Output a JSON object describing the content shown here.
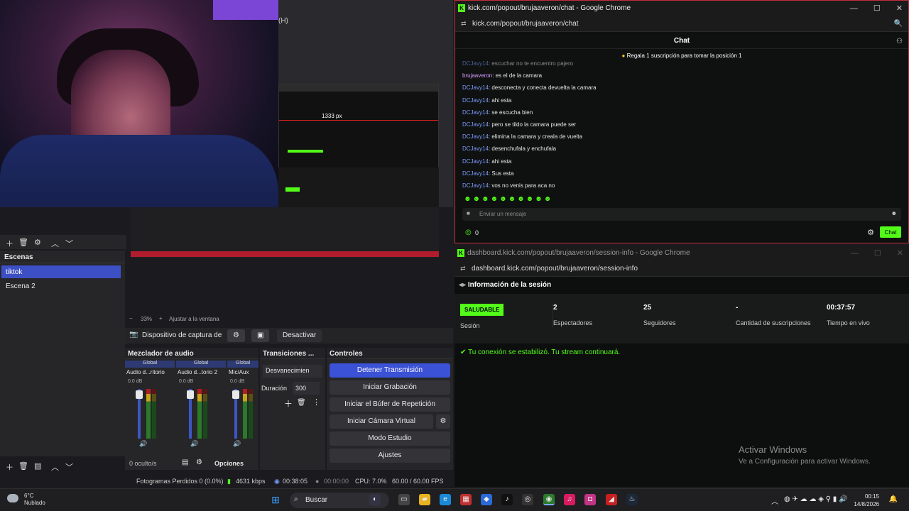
{
  "obs": {
    "shortcut_label": "(H)",
    "preview_label": "1333 px",
    "zoom": "33%",
    "fit_label": "Ajustar a la ventana",
    "scenes_title": "Escenas",
    "scenes": [
      "tiktok",
      "Escena 2"
    ],
    "source_name": "Dispositivo de captura de v",
    "deactivate": "Desactivar",
    "mixer_title": "Mezclador de audio",
    "channels": [
      {
        "group": "Global",
        "name": "Audio d...ritorio",
        "db": "0.0 dB"
      },
      {
        "group": "Global",
        "name": "Audio d...torio 2",
        "db": "0.0 dB"
      },
      {
        "group": "Global",
        "name": "Mic/Aux",
        "db": "0.0 dB"
      }
    ],
    "hidden_count": "0 oculto/s",
    "transitions_title": "Transiciones ...",
    "transition": "Desvanecimien",
    "duration_label": "Duración",
    "duration_value": "300",
    "controls_title": "Controles",
    "controls": [
      "Detener Transmisión",
      "Iniciar Grabación",
      "Iniciar el Búfer de Repetición",
      "Iniciar Cámara Virtual",
      "Modo Estudio",
      "Ajustes"
    ],
    "options": "Opciones",
    "status": {
      "dropped": "Fotogramas Perdidos 0 (0.0%)",
      "kbps": "4631 kbps",
      "stream_time": "00:38:05",
      "rec_time": "00:00:00",
      "cpu": "CPU: 7.0%",
      "fps": "60.00 / 60.00 FPS"
    }
  },
  "chat_window": {
    "title": "kick.com/popout/brujaaveron/chat - Google Chrome",
    "url": "kick.com/popout/brujaaveron/chat",
    "header": "Chat",
    "pinned": "Regala 1 suscripción para tomar la posición 1",
    "messages": [
      {
        "user": "DCJavy14",
        "text": ": escuchar no te encuentro pajero"
      },
      {
        "user": "brujaaveron",
        "text": ": es el de la camara"
      },
      {
        "user": "DCJavy14",
        "text": ": desconecta y conecta devuelta la camara"
      },
      {
        "user": "DCJavy14",
        "text": ": ahi esta"
      },
      {
        "user": "DCJavy14",
        "text": ": se escucha bien"
      },
      {
        "user": "DCJavy14",
        "text": ": pero se tildo la camara puede ser"
      },
      {
        "user": "DCJavy14",
        "text": ": elimina la camara y creala de vuelta"
      },
      {
        "user": "DCJavy14",
        "text": ": desenchufala y enchufala"
      },
      {
        "user": "DCJavy14",
        "text": ": ahi esta"
      },
      {
        "user": "DCJavy14",
        "text": ": Sus esta"
      },
      {
        "user": "DCJavy14",
        "text": ": vos no venis para aca no"
      }
    ],
    "emotes": "☻☻☻☻☻☻☻☻☻☻",
    "input_placeholder": "Enviar un mensaje",
    "points": "0",
    "send": "Chat"
  },
  "session_window": {
    "title": "dashboard.kick.com/popout/brujaaveron/session-info - Google Chrome",
    "url": "dashboard.kick.com/popout/brujaaveron/session-info",
    "header": "Información de la sesión",
    "stats": [
      {
        "value": "SALUDABLE",
        "label": "Sesión"
      },
      {
        "value": "2",
        "label": "Espectadores"
      },
      {
        "value": "25",
        "label": "Seguidores"
      },
      {
        "value": "-",
        "label": "Cantidad de suscripciones"
      },
      {
        "value": "00:37:57",
        "label": "Tiempo en vivo"
      }
    ],
    "connection": "Tu conexión se estabilizó. Tu stream continuará."
  },
  "activate_windows": {
    "line1": "Activar Windows",
    "line2": "Ve a Configuración para activar Windows."
  },
  "taskbar": {
    "temp": "6°C",
    "weather": "Nublado",
    "search": "Buscar",
    "time": "00:15",
    "date": "14/8/2026"
  },
  "colors": {
    "kick_green": "#53fc18",
    "obs_blue": "#3b51d6",
    "username_blue": "#7b9cff"
  }
}
